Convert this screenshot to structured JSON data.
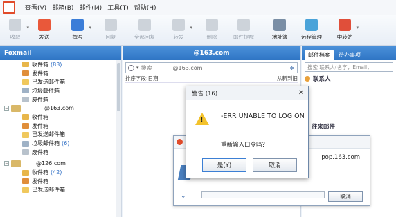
{
  "menubar": {
    "items": [
      "查看(V)",
      "邮箱(B)",
      "邮件(M)",
      "工具(T)",
      "帮助(H)"
    ]
  },
  "toolbar": {
    "buttons": [
      {
        "label": "收取",
        "icon": "receive-icon",
        "enabled": false
      },
      {
        "label": "发送",
        "icon": "send-icon",
        "enabled": true
      },
      {
        "label": "撰写",
        "icon": "compose-icon",
        "enabled": true
      },
      {
        "label": "回复",
        "icon": "reply-icon",
        "enabled": false
      },
      {
        "label": "全部回复",
        "icon": "reply-all-icon",
        "enabled": false
      },
      {
        "label": "转发",
        "icon": "forward-icon",
        "enabled": false
      },
      {
        "label": "删除",
        "icon": "delete-icon",
        "enabled": false
      },
      {
        "label": "邮件提醒",
        "icon": "reminder-icon",
        "enabled": false
      },
      {
        "label": "地址簿",
        "icon": "address-book-icon",
        "enabled": true
      },
      {
        "label": "远程管理",
        "icon": "remote-icon",
        "enabled": true
      },
      {
        "label": "中转站",
        "icon": "transfer-icon",
        "enabled": true
      }
    ]
  },
  "leftpane": {
    "title": "Foxmail",
    "account1": {
      "folders": [
        {
          "label": "收件箱",
          "count": "(83)"
        },
        {
          "label": "发件箱",
          "count": ""
        },
        {
          "label": "已发送邮件箱",
          "count": ""
        },
        {
          "label": "垃圾邮件箱",
          "count": ""
        },
        {
          "label": "废件箱",
          "count": ""
        }
      ]
    },
    "account2": {
      "name": "@163.com",
      "folders": [
        {
          "label": "收件箱",
          "count": ""
        },
        {
          "label": "发件箱",
          "count": ""
        },
        {
          "label": "已发送邮件箱",
          "count": ""
        },
        {
          "label": "垃圾邮件箱",
          "count": "(6)"
        },
        {
          "label": "废件箱",
          "count": ""
        }
      ]
    },
    "account3": {
      "name": "@126.com",
      "folders": [
        {
          "label": "收件箱",
          "count": "(42)"
        },
        {
          "label": "发件箱",
          "count": ""
        },
        {
          "label": "已发送邮件箱",
          "count": ""
        }
      ]
    }
  },
  "midpane": {
    "title": "@163.com",
    "search_placeholder": "搜索",
    "search_value": "@163.com",
    "sort_label": "排序字段:日期",
    "sort_order": "从新到旧"
  },
  "rightpane": {
    "tabs": [
      "邮件档案",
      "待办事项"
    ],
    "search_placeholder": "搜索 联系人(名字，Email，",
    "contacts_header": "联系人",
    "recent_header": "往来邮件"
  },
  "progress_dialog": {
    "server": "pop.163.com",
    "cancel_label": "取消"
  },
  "alert_dialog": {
    "title": "警告 (16)",
    "close": "✕",
    "message": "-ERR UNABLE TO LOG ON",
    "question": "重新输入口令吗？",
    "yes_label": "是(Y)",
    "no_label": "取消"
  }
}
